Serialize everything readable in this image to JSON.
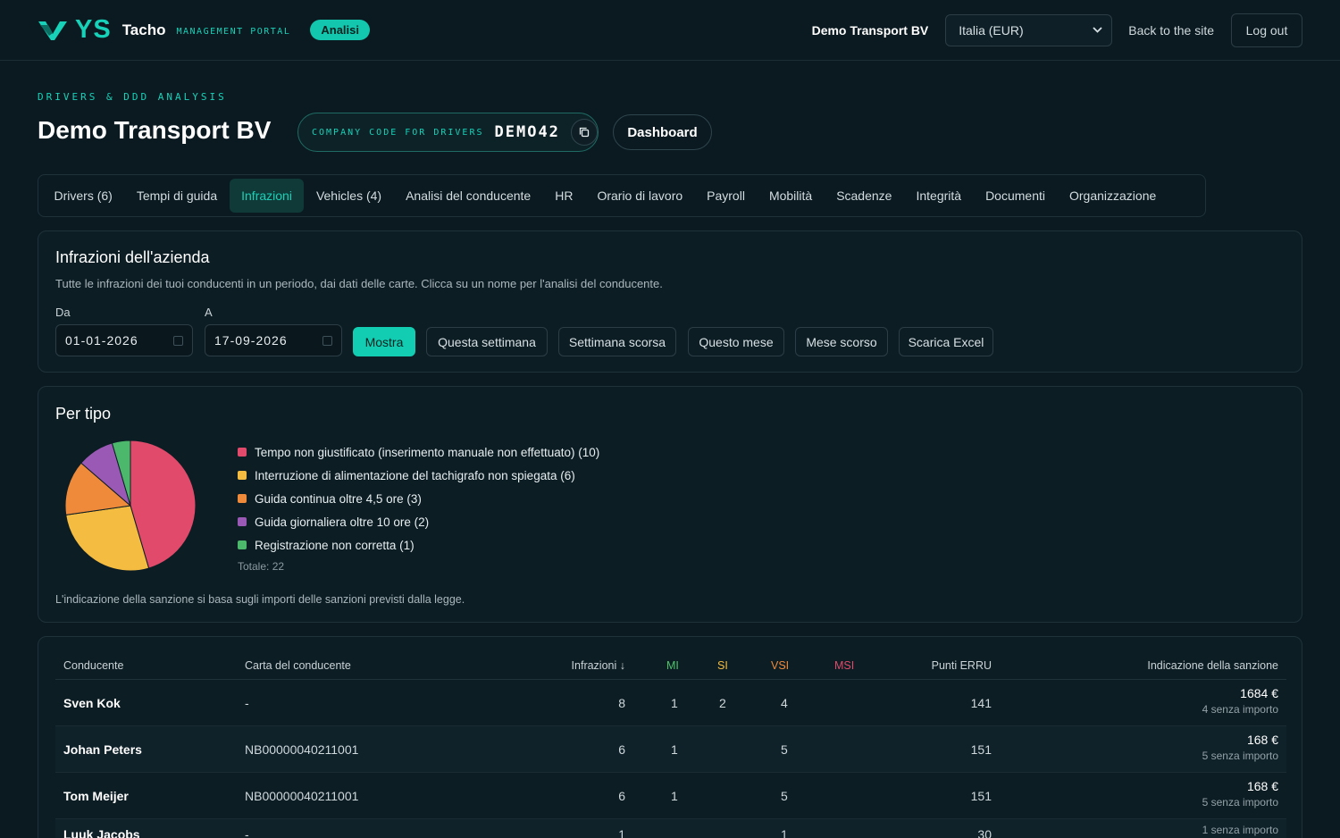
{
  "header": {
    "brand_mark": "YS",
    "brand_name": "Tacho",
    "brand_sub": "MANAGEMENT PORTAL",
    "badge": "Analisi",
    "company": "Demo Transport BV",
    "region_select": "Italia (EUR)",
    "back_link": "Back to the site",
    "logout": "Log out",
    "accent": "#17d1b8"
  },
  "page": {
    "kicker": "DRIVERS & DDD ANALYSIS",
    "title": "Demo Transport BV",
    "code_label": "COMPANY CODE FOR DRIVERS",
    "code_value": "DEMO42",
    "dashboard_button": "Dashboard"
  },
  "tabs": [
    {
      "label": "Drivers (6)"
    },
    {
      "label": "Tempi di guida"
    },
    {
      "label": "Infrazioni",
      "active": true
    },
    {
      "label": "Vehicles (4)"
    },
    {
      "label": "Analisi del conducente"
    },
    {
      "label": "HR"
    },
    {
      "label": "Orario di lavoro"
    },
    {
      "label": "Payroll"
    },
    {
      "label": "Mobilità"
    },
    {
      "label": "Scadenze"
    },
    {
      "label": "Integrità"
    },
    {
      "label": "Documenti"
    },
    {
      "label": "Organizzazione"
    }
  ],
  "filters": {
    "title": "Infrazioni dell'azienda",
    "description": "Tutte le infrazioni dei tuoi conducenti in un periodo, dai dati delle carte. Clicca su un nome per l'analisi del conducente.",
    "from_label": "Da",
    "from_value": "01-01-2026",
    "to_label": "A",
    "to_value": "17-09-2026",
    "show_button": "Mostra",
    "this_week": "Questa settimana",
    "last_week": "Settimana scorsa",
    "this_month": "Questo mese",
    "last_month": "Mese scorso",
    "excel": "Scarica Excel"
  },
  "by_type": {
    "title": "Per tipo",
    "total": "Totale: 22",
    "footnote": "L'indicazione della sanzione si basa sugli importi delle sanzioni previsti dalla legge."
  },
  "chart_data": {
    "type": "pie",
    "slices": [
      {
        "label": "Tempo non giustificato (inserimento manuale non effettuato) (10)",
        "value": 10,
        "color": "#e14a6a"
      },
      {
        "label": "Interruzione di alimentazione del tachigrafo non spiegata (6)",
        "value": 6,
        "color": "#f4bd42"
      },
      {
        "label": "Guida continua oltre 4,5 ore (3)",
        "value": 3,
        "color": "#ef8a3a"
      },
      {
        "label": "Guida giornaliera oltre 10 ore (2)",
        "value": 2,
        "color": "#9b59b6"
      },
      {
        "label": "Registrazione non corretta (1)",
        "value": 1,
        "color": "#4cb86b"
      }
    ]
  },
  "table": {
    "headers": {
      "driver": "Conducente",
      "card": "Carta del conducente",
      "infractions": "Infrazioni ↓",
      "mi": "MI",
      "si": "SI",
      "vsi": "VSI",
      "msi": "MSI",
      "erru": "Punti ERRU",
      "sanction": "Indicazione della sanzione"
    },
    "header_colors": {
      "mi": "#4cc46a",
      "si": "#f4bd42",
      "vsi": "#ef8a3a",
      "msi": "#e14a6a"
    },
    "rows": [
      {
        "driver": "Sven Kok",
        "card": "-",
        "infractions": "8",
        "mi": "1",
        "si": "2",
        "vsi": "4",
        "msi": "",
        "erru": "141",
        "amount": "1684 €",
        "no_amount": "4 senza importo"
      },
      {
        "driver": "Johan Peters",
        "card": "NB00000040211001",
        "infractions": "6",
        "mi": "1",
        "si": "",
        "vsi": "5",
        "msi": "",
        "erru": "151",
        "amount": "168 €",
        "no_amount": "5 senza importo"
      },
      {
        "driver": "Tom Meijer",
        "card": "NB00000040211001",
        "infractions": "6",
        "mi": "1",
        "si": "",
        "vsi": "5",
        "msi": "",
        "erru": "151",
        "amount": "168 €",
        "no_amount": "5 senza importo"
      },
      {
        "driver": "Luuk Jacobs",
        "card": "-",
        "infractions": "1",
        "mi": "",
        "si": "",
        "vsi": "1",
        "msi": "",
        "erru": "30",
        "amount": "",
        "no_amount": "1 senza importo"
      }
    ]
  }
}
